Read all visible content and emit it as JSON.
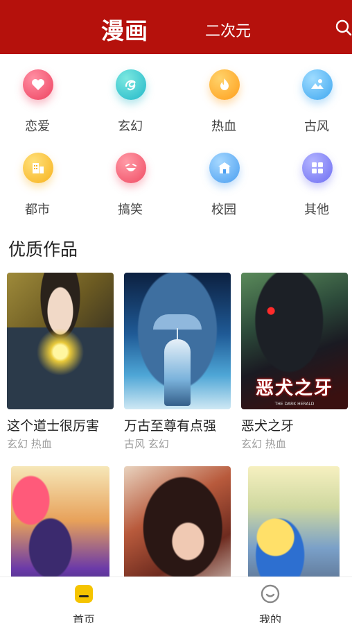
{
  "header": {
    "active_tab": "漫画",
    "tab": "二次元",
    "search_icon": "search-icon",
    "background": "#b5110c"
  },
  "categories": [
    {
      "label": "恋爱",
      "icon": "heart-icon",
      "color": "#ee4260"
    },
    {
      "label": "玄幻",
      "icon": "swirl-icon",
      "color": "#22b8c9"
    },
    {
      "label": "热血",
      "icon": "flame-icon",
      "color": "#ff9e1b"
    },
    {
      "label": "古风",
      "icon": "landscape-icon",
      "color": "#3ea7f0"
    },
    {
      "label": "都市",
      "icon": "building-icon",
      "color": "#f7b21d"
    },
    {
      "label": "搞笑",
      "icon": "laugh-icon",
      "color": "#f04b63"
    },
    {
      "label": "校园",
      "icon": "school-icon",
      "color": "#4a9ef0"
    },
    {
      "label": "其他",
      "icon": "grid-icon",
      "color": "#6e6ef2"
    }
  ],
  "section": {
    "title": "优质作品"
  },
  "comics": [
    {
      "title": "这个道士很厉害",
      "tags": "玄幻 热血"
    },
    {
      "title": "万古至尊有点强",
      "tags": "古风 玄幻"
    },
    {
      "title": "恶犬之牙",
      "tags": "玄幻 热血",
      "cover_text": "恶犬之牙",
      "cover_subtext": "THE DARK HERALD"
    },
    {
      "title": "",
      "tags": ""
    },
    {
      "title": "",
      "tags": ""
    },
    {
      "title": "",
      "tags": ""
    }
  ],
  "bottom_nav": [
    {
      "label": "首页",
      "icon": "home-icon",
      "active": true,
      "color": "#f5c400"
    },
    {
      "label": "我的",
      "icon": "profile-icon",
      "active": false,
      "color": "#888888"
    }
  ]
}
